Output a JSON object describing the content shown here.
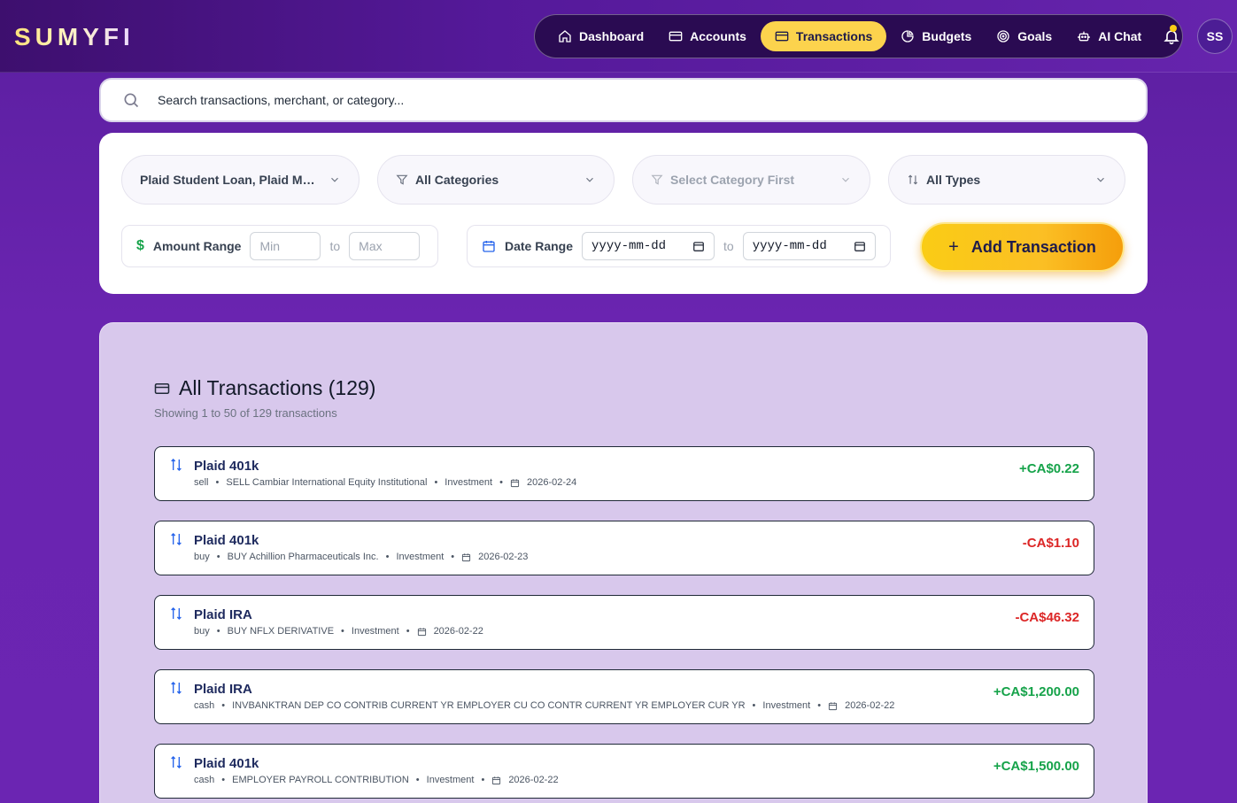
{
  "app": {
    "logo": "SUMYFI",
    "avatar_initials": "SS"
  },
  "nav": {
    "items": [
      {
        "label": "Dashboard",
        "icon": "home-icon",
        "active": false
      },
      {
        "label": "Accounts",
        "icon": "credit-card-icon",
        "active": false
      },
      {
        "label": "Transactions",
        "icon": "credit-card-icon",
        "active": true
      },
      {
        "label": "Budgets",
        "icon": "pie-chart-icon",
        "active": false
      },
      {
        "label": "Goals",
        "icon": "target-icon",
        "active": false
      },
      {
        "label": "AI Chat",
        "icon": "bot-icon",
        "active": false
      }
    ],
    "notification_badge_color": "#facc15"
  },
  "search": {
    "placeholder": "Search transactions, merchant, or category..."
  },
  "filters": {
    "account_select": "Plaid Student Loan, Plaid Mor...",
    "category_select": "All Categories",
    "subcategory_select": "Select Category First",
    "type_select": "All Types",
    "amount_range_label": "Amount Range",
    "amount_min_placeholder": "Min",
    "amount_max_placeholder": "Max",
    "to_label": "to",
    "date_range_label": "Date Range",
    "date_from_placeholder": "yyyy-mm-dd",
    "date_to_placeholder": "yyyy-mm-dd",
    "add_button_label": "Add Transaction"
  },
  "transactions": {
    "title": "All Transactions (129)",
    "subtitle": "Showing 1 to 50 of 129 transactions",
    "rows": [
      {
        "account": "Plaid 401k",
        "type": "sell",
        "description": "SELL Cambiar International Equity Institutional",
        "category": "Investment",
        "date": "2026-02-24",
        "amount": "+CA$0.22",
        "positive": true
      },
      {
        "account": "Plaid 401k",
        "type": "buy",
        "description": "BUY Achillion Pharmaceuticals Inc.",
        "category": "Investment",
        "date": "2026-02-23",
        "amount": "-CA$1.10",
        "positive": false
      },
      {
        "account": "Plaid IRA",
        "type": "buy",
        "description": "BUY NFLX DERIVATIVE",
        "category": "Investment",
        "date": "2026-02-22",
        "amount": "-CA$46.32",
        "positive": false
      },
      {
        "account": "Plaid IRA",
        "type": "cash",
        "description": "INVBANKTRAN DEP CO CONTRIB CURRENT YR EMPLOYER CU CO CONTR CURRENT YR EMPLOYER CUR YR",
        "category": "Investment",
        "date": "2026-02-22",
        "amount": "+CA$1,200.00",
        "positive": true
      },
      {
        "account": "Plaid 401k",
        "type": "cash",
        "description": "EMPLOYER PAYROLL CONTRIBUTION",
        "category": "Investment",
        "date": "2026-02-22",
        "amount": "+CA$1,500.00",
        "positive": true
      }
    ]
  }
}
